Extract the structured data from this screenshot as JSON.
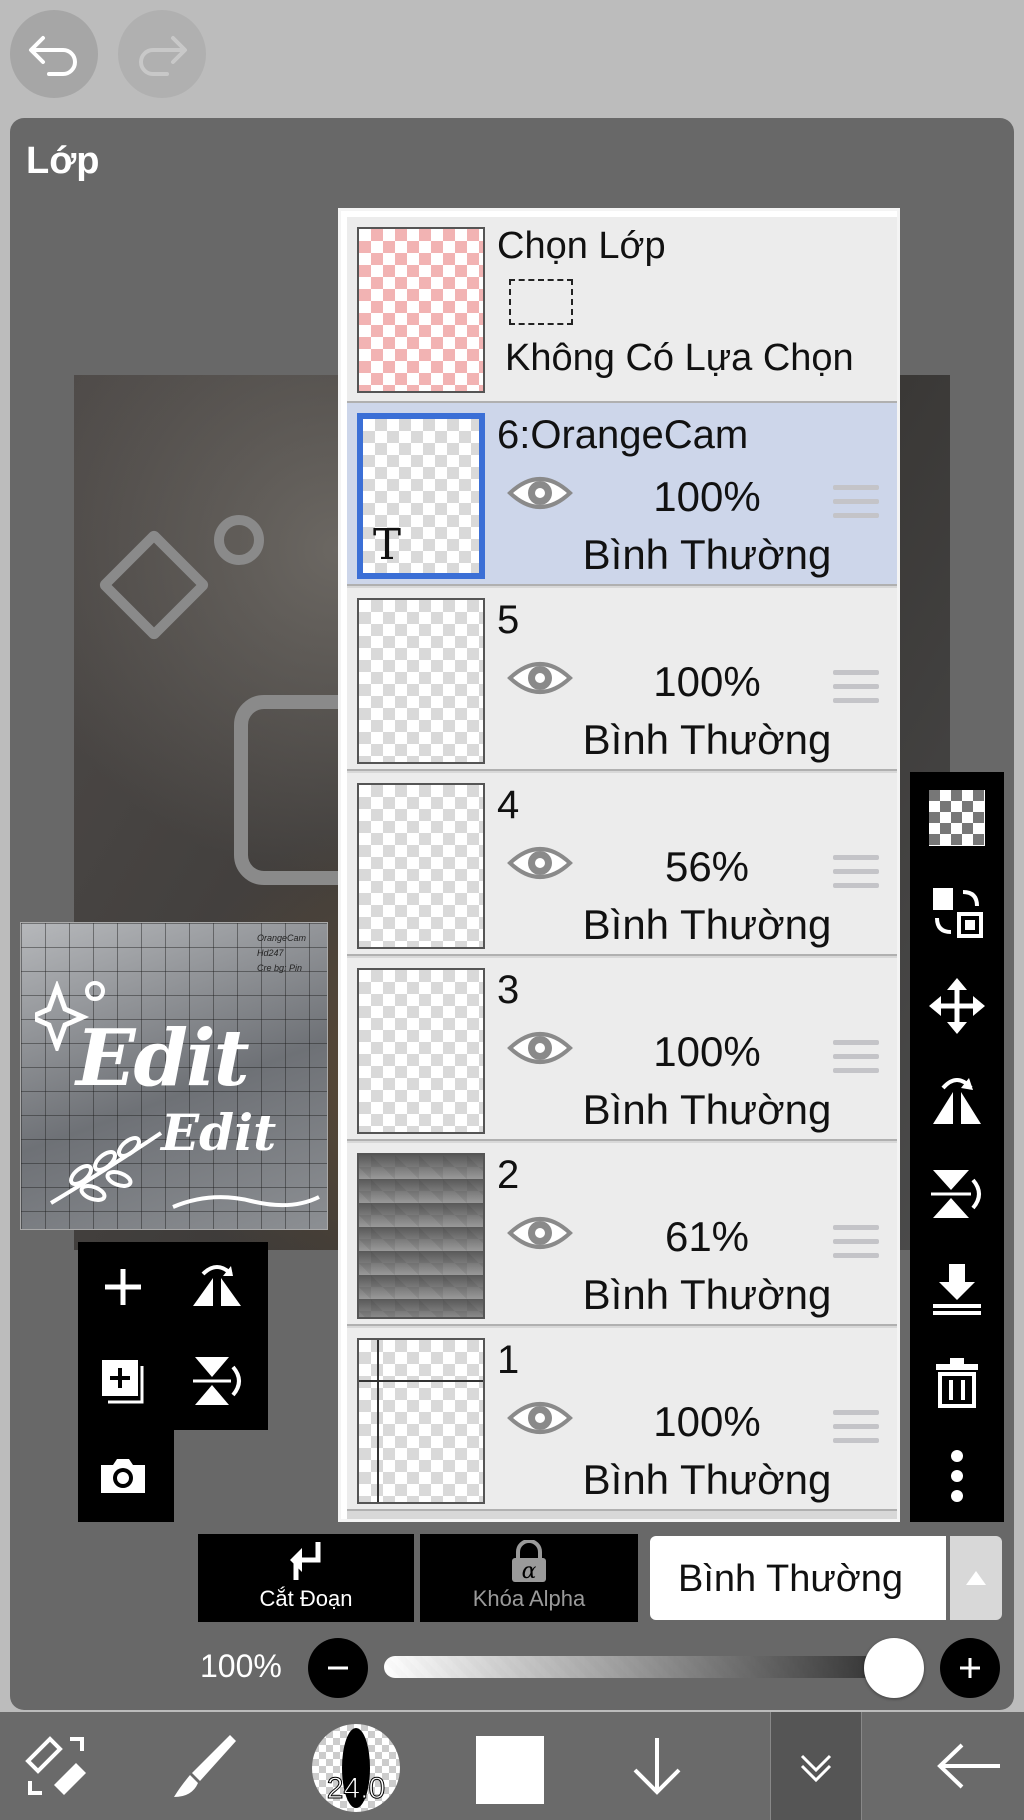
{
  "panel": {
    "title": "Lớp"
  },
  "selection": {
    "title": "Chọn Lớp",
    "subtitle": "Không Có Lựa Chọn"
  },
  "thumbnail": {
    "meta": [
      "OrangeCam",
      "Hd247",
      "Cre bg: Pin"
    ],
    "line1": "Edit",
    "line2": "Edit"
  },
  "layers": [
    {
      "name": "6:OrangeCam",
      "opacity": "100%",
      "blend": "Bình Thường",
      "selected": true,
      "type_icon": "T"
    },
    {
      "name": "5",
      "opacity": "100%",
      "blend": "Bình Thường",
      "selected": false
    },
    {
      "name": "4",
      "opacity": "56%",
      "blend": "Bình Thường",
      "selected": false
    },
    {
      "name": "3",
      "opacity": "100%",
      "blend": "Bình Thường",
      "selected": false
    },
    {
      "name": "2",
      "opacity": "61%",
      "blend": "Bình Thường",
      "selected": false
    },
    {
      "name": "1",
      "opacity": "100%",
      "blend": "Bình Thường",
      "selected": false
    }
  ],
  "controls": {
    "clip_label": "Cắt Đoạn",
    "lock_label": "Khóa Alpha",
    "blend_mode": "Bình Thường",
    "opacity_label": "100%",
    "opacity_value": 1.0
  },
  "toolbar": {
    "brush_size": "24.0",
    "color": "#ffffff"
  },
  "icons": {
    "undo": "undo-icon",
    "redo": "redo-icon",
    "add_layer": "plus-icon",
    "flip_h": "flip-horizontal-icon",
    "add_copy": "add-layer-copy-icon",
    "flip_v": "flip-vertical-icon",
    "camera": "camera-icon",
    "transparent": "checkerboard-icon",
    "swap": "swap-layers-icon",
    "move": "move-icon",
    "rotate_flip": "flip-rotate-icon",
    "rotate_flip_v": "flip-rotate-vertical-icon",
    "merge_down": "merge-down-icon",
    "delete": "trash-icon",
    "more": "more-vertical-icon"
  }
}
